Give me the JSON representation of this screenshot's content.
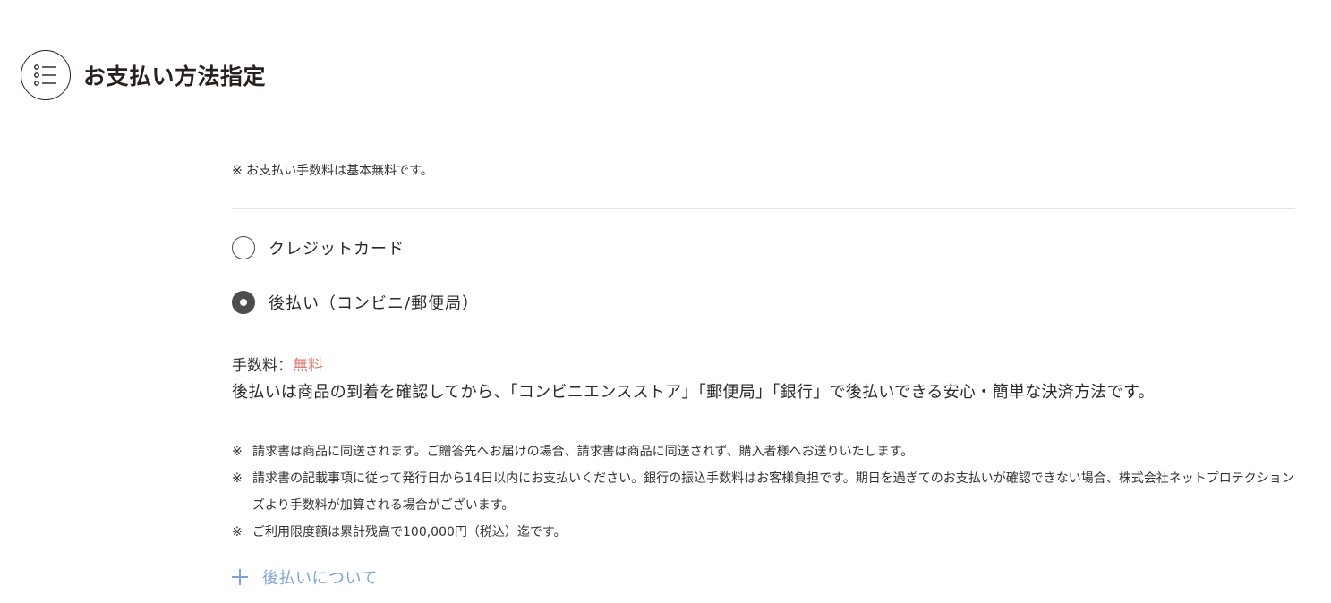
{
  "header": {
    "icon": "list-icon",
    "title": "お支払い方法指定"
  },
  "fee_note": "※ お支払い手数料は基本無料です。",
  "payment_options": [
    {
      "label": "クレジットカード",
      "checked": false
    },
    {
      "label": "後払い（コンビニ/郵便局）",
      "checked": true
    }
  ],
  "detail": {
    "fee_label": "手数料：",
    "fee_value": "無料",
    "description": "後払いは商品の到着を確認してから、「コンビニエンスストア」「郵便局」「銀行」で後払いできる安心・簡単な決済方法です。",
    "note_mark": "※",
    "notes": [
      "請求書は商品に同送されます。ご贈答先へお届けの場合、請求書は商品に同送されず、購入者様へお送りいたします。",
      "請求書の記載事項に従って発行日から14日以内にお支払いください。銀行の振込手数料はお客様負担です。期日を過ぎてのお支払いが確認できない場合、株式会社ネットプロテクションズより手数料が加算される場合がございます。",
      "ご利用限度額は累計残高で100,000円（税込）迄です。"
    ]
  },
  "accordion": {
    "icon": "plus-icon",
    "label": "後払いについて"
  },
  "colors": {
    "title": "#2a1f1f",
    "fee_free": "#e0796f",
    "link": "#7fa3d6",
    "radio_checked": "#4d4d4d",
    "divider": "#e4e4e4"
  }
}
